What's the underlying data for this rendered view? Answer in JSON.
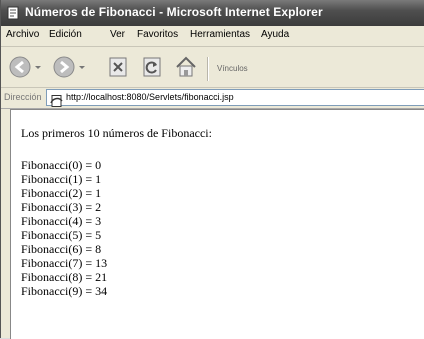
{
  "window": {
    "title": "Números de Fibonacci - Microsoft Internet Explorer"
  },
  "menubar": {
    "items": [
      "Archivo",
      "Edición",
      "Ver",
      "Favoritos",
      "Herramientas",
      "Ayuda"
    ]
  },
  "toolbar": {
    "back_icon": "back-arrow-icon",
    "forward_icon": "forward-arrow-icon",
    "stop_icon": "stop-icon",
    "refresh_icon": "refresh-icon",
    "home_icon": "home-icon",
    "links_label": "Vínculos"
  },
  "address": {
    "label": "Dirección",
    "url": "http://localhost:8080/Servlets/fibonacci.jsp"
  },
  "content": {
    "heading": "Los primeros 10 números de Fibonacci:",
    "lines": [
      "Fibonacci(0) = 0",
      "Fibonacci(1) = 1",
      "Fibonacci(2) = 1",
      "Fibonacci(3) = 2",
      "Fibonacci(4) = 3",
      "Fibonacci(5) = 5",
      "Fibonacci(6) = 8",
      "Fibonacci(7) = 13",
      "Fibonacci(8) = 21",
      "Fibonacci(9) = 34"
    ]
  }
}
